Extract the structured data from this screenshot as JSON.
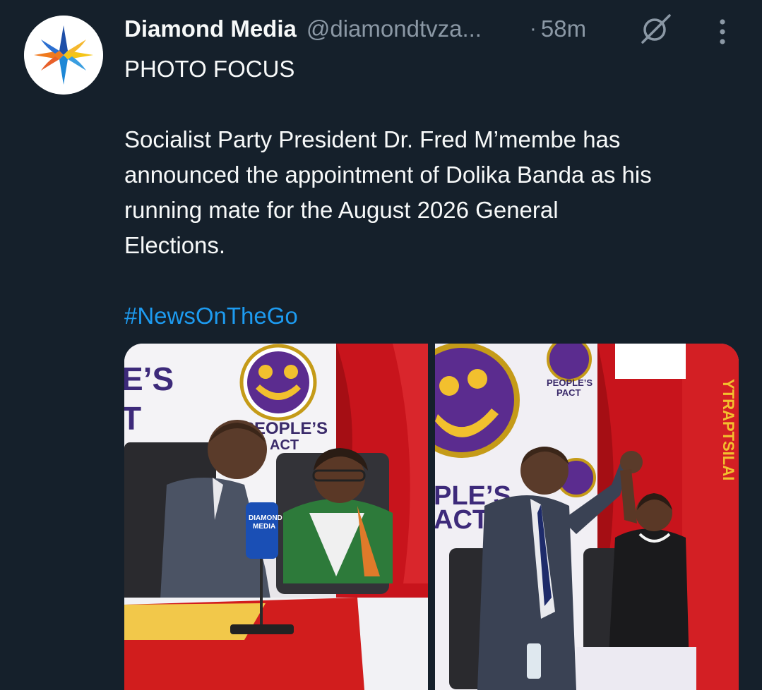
{
  "author": {
    "display_name": "Diamond Media",
    "handle": "@diamondtvza...",
    "time_separator": "·",
    "timestamp": "58m",
    "avatar_icon": "diamond-media-logo-icon"
  },
  "actions": {
    "grok_icon": "grok-icon",
    "more_icon": "more-vertical-icon"
  },
  "tweet": {
    "line1": "PHOTO FOCUS",
    "line2": "Socialist Party President Dr. Fred M’membe has",
    "line3": "announced the appointment of Dolika Banda as his",
    "line4": "running mate for the August 2026 General",
    "line5": "Elections.",
    "hashtag": "#NewsOnTheGo"
  },
  "photos": {
    "left": {
      "banner_text_1": "E’S",
      "banner_text_2": "T",
      "logo_text_1": "PEOPLE’S",
      "logo_text_2": "ACT",
      "mic_text_1": "DIAMOND",
      "mic_text_2": "MEDIA"
    },
    "right": {
      "logo_text_1": "PEOPLE’S",
      "logo_text_2": "PACT",
      "banner_text_1": "PLE’S",
      "banner_text_2": "ACT",
      "flag_text": "YTRAPTSILAI"
    }
  },
  "colors": {
    "background": "#15202b",
    "text": "#f7f9f9",
    "muted": "#8b98a5",
    "link": "#1d9bf0"
  }
}
